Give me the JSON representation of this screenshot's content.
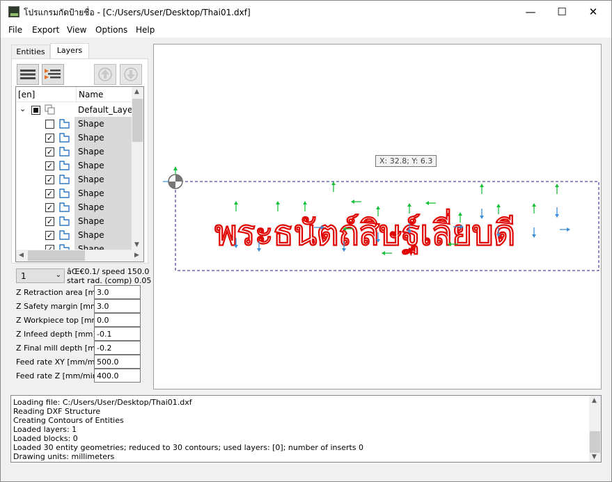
{
  "window": {
    "title": "โปรแกรมกัดป้ายชื่อ - [C:/Users/User/Desktop/Thai01.dxf]",
    "minimize": "—",
    "maximize": "☐",
    "close": "✕"
  },
  "menu": [
    "File",
    "Export",
    "View",
    "Options",
    "Help"
  ],
  "tabs": [
    "Entities",
    "Layers"
  ],
  "tree": {
    "col_en": "[en]",
    "col_name": "Name",
    "layer_name": "Default_Layer",
    "shapes": [
      {
        "label": "Shape",
        "checked": false
      },
      {
        "label": "Shape",
        "checked": true
      },
      {
        "label": "Shape",
        "checked": true
      },
      {
        "label": "Shape",
        "checked": true
      },
      {
        "label": "Shape",
        "checked": true
      },
      {
        "label": "Shape",
        "checked": true
      },
      {
        "label": "Shape",
        "checked": true
      },
      {
        "label": "Shape",
        "checked": true
      },
      {
        "label": "Shape",
        "checked": true
      },
      {
        "label": "Shape",
        "checked": true
      }
    ]
  },
  "tool": {
    "selected": "1",
    "info_line1": "âŒ€0.1/ speed 150.0",
    "info_line2": "start rad. (comp) 0.05"
  },
  "params": [
    {
      "label": "Z Retraction area [mm]",
      "value": "3.0"
    },
    {
      "label": "Z Safety margin   [mm]",
      "value": "3.0"
    },
    {
      "label": "Z Workpiece top   [mm]",
      "value": "0.0"
    },
    {
      "label": "Z Infeed depth    [mm]",
      "value": "-0.1"
    },
    {
      "label": "Z Final mill depth [mm]",
      "value": "-0.2"
    },
    {
      "label": "Feed rate XY  [mm/min]",
      "value": "500.0"
    },
    {
      "label": "Feed rate Z   [mm/min]",
      "value": "400.0"
    }
  ],
  "canvas": {
    "coord_tooltip": "X: 32.8; Y: 6.3",
    "drawing_text": "พระธนัตถ์สิษฐ์เลี่ยบดี",
    "drawing_color": "#e00000",
    "arrow_green": "#19c03a",
    "arrow_blue": "#3a8fd8"
  },
  "log": [
    "Loading file: C:/Users/User/Desktop/Thai01.dxf",
    "Reading DXF Structure",
    "Creating Contours of Entities",
    "Loaded layers: 1",
    "Loaded blocks: 0",
    "Loaded 30 entity geometries; reduced to 30 contours; used layers: [0]; number of inserts 0",
    "Drawing units: millimeters"
  ]
}
